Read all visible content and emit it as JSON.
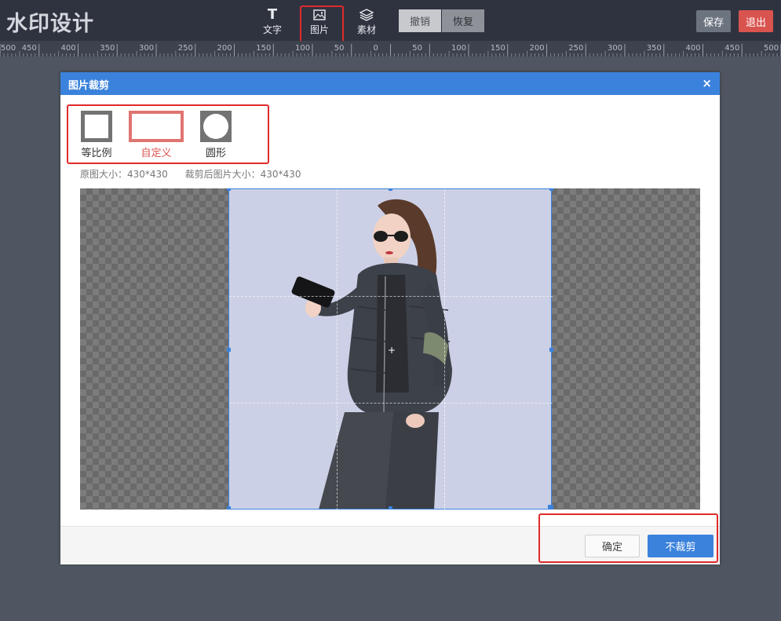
{
  "app": {
    "logo": "水印设计"
  },
  "toolbar": {
    "tools": [
      {
        "label": "文字",
        "icon": "text-icon",
        "glyph": "T"
      },
      {
        "label": "图片",
        "icon": "image-icon"
      },
      {
        "label": "素材",
        "icon": "layers-icon"
      }
    ],
    "undo_label": "撤销",
    "redo_label": "恢复",
    "save_label": "保存",
    "exit_label": "退出"
  },
  "ruler": {
    "ticks": [
      "500",
      "450",
      "400",
      "350",
      "300",
      "250",
      "200",
      "150",
      "100",
      "50",
      "0",
      "50",
      "100",
      "150",
      "200",
      "250",
      "300",
      "350",
      "400",
      "450",
      "500"
    ]
  },
  "dialog": {
    "title": "图片裁剪",
    "close_glyph": "×",
    "modes": [
      {
        "label": "等比例",
        "selected": false
      },
      {
        "label": "自定义",
        "selected": true
      },
      {
        "label": "圆形",
        "selected": false
      }
    ],
    "original_size": "原图大小：430*430",
    "cropped_size": "裁剪后图片大小：430*430",
    "center_glyph": "+",
    "confirm_label": "确定",
    "no_crop_label": "不裁剪"
  },
  "colors": {
    "accent": "#3b82dc",
    "danger": "#d9534f",
    "highlight_outline": "#e02a2a"
  }
}
